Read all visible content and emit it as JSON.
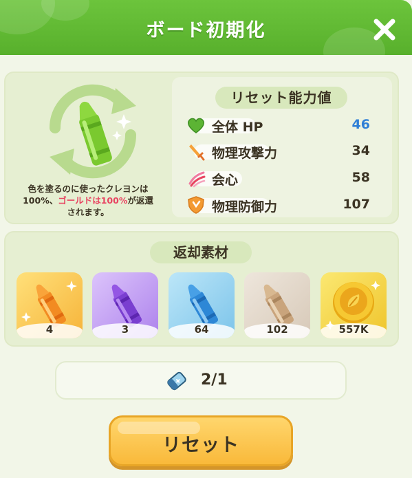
{
  "header": {
    "title": "ボード初期化",
    "close_icon": "close-icon"
  },
  "reset_stats": {
    "title": "リセット能力値",
    "stats": [
      {
        "label": "全体 HP",
        "value": "46",
        "icon": "heart-icon",
        "value_color": "#2f7fd6"
      },
      {
        "label": "物理攻撃力",
        "value": "34",
        "icon": "sword-icon",
        "value_color": "#3b3323"
      },
      {
        "label": "会心",
        "value": "58",
        "icon": "claw-icon",
        "value_color": "#3b3323"
      },
      {
        "label": "物理防御力",
        "value": "107",
        "icon": "shield-icon",
        "value_color": "#3b3323"
      }
    ]
  },
  "description": {
    "line1": "色を塗るのに使ったクレヨンは",
    "line2_a": "100%、",
    "line2_highlight": "ゴールドは100%",
    "line2_b": "が返還",
    "line3": "されます。"
  },
  "materials": {
    "title": "返却素材",
    "items": [
      {
        "name": "orange-crayon-icon",
        "count": "4",
        "bg": "#f9c84e"
      },
      {
        "name": "purple-crayon-icon",
        "count": "3",
        "bg": "#c39ef0"
      },
      {
        "name": "blue-crayon-icon",
        "count": "64",
        "bg": "#95d2ef"
      },
      {
        "name": "beige-crayon-icon",
        "count": "102",
        "bg": "#e3d9cd"
      },
      {
        "name": "gold-coin-icon",
        "count": "557K",
        "bg": "#f5d945"
      }
    ]
  },
  "ticket": {
    "count": "2/1",
    "icon": "eraser-ticket-icon"
  },
  "reset_button": {
    "label": "リセット"
  },
  "colors": {
    "header": "#5db832",
    "accent_highlight": "#e84562",
    "button": "#fcc64e"
  }
}
